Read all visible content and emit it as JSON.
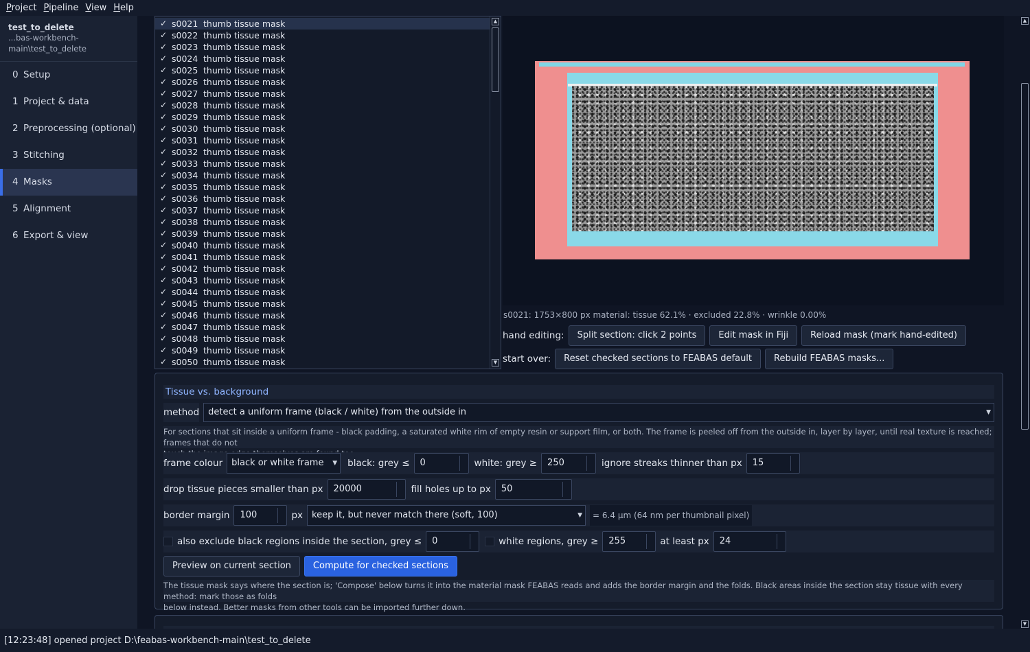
{
  "menu": [
    {
      "label": "Project",
      "ul": "P",
      "rest": "roject"
    },
    {
      "label": "Pipeline",
      "ul": "P",
      "rest": "ipeline"
    },
    {
      "label": "View",
      "ul": "V",
      "rest": "iew"
    },
    {
      "label": "Help",
      "ul": "H",
      "rest": "elp"
    }
  ],
  "sidebar": {
    "project_name": "test_to_delete",
    "project_path_1": "...bas-workbench-",
    "project_path_2": "main\\test_to_delete",
    "items": [
      {
        "num": "0",
        "label": "Setup"
      },
      {
        "num": "1",
        "label": "Project & data"
      },
      {
        "num": "2",
        "label": "Preprocessing (optional)"
      },
      {
        "num": "3",
        "label": "Stitching"
      },
      {
        "num": "4",
        "label": "Masks",
        "active": true
      },
      {
        "num": "5",
        "label": "Alignment"
      },
      {
        "num": "6",
        "label": "Export & view"
      }
    ]
  },
  "section_list": {
    "check_glyph": "✓",
    "kind": "thumb tissue mask",
    "rows": [
      "s0021",
      "s0022",
      "s0023",
      "s0024",
      "s0025",
      "s0026",
      "s0027",
      "s0028",
      "s0029",
      "s0030",
      "s0031",
      "s0032",
      "s0033",
      "s0034",
      "s0035",
      "s0036",
      "s0037",
      "s0038",
      "s0039",
      "s0040",
      "s0041",
      "s0042",
      "s0043",
      "s0044",
      "s0045",
      "s0046",
      "s0047",
      "s0048",
      "s0049",
      "s0050"
    ]
  },
  "preview": {
    "info": "s0021: 1753×800 px   material: tissue 62.1% · excluded 22.8% · wrinkle 0.00%",
    "colors": {
      "excluded": "#ef8f8f",
      "border": "#8ad9e8"
    }
  },
  "hand_editing": {
    "label": "hand editing:",
    "split": "Split section: click 2 points",
    "edit_fiji": "Edit mask in Fiji",
    "reload": "Reload mask (mark hand-edited)"
  },
  "start_over": {
    "label": "start over:",
    "reset": "Reset checked sections to FEABAS default",
    "rebuild": "Rebuild FEABAS masks..."
  },
  "tissue": {
    "title": "Tissue vs. background",
    "method_label": "method",
    "method_value": "detect a uniform frame (black / white) from the outside in",
    "method_desc_1": "For sections that sit inside a uniform frame - black padding, a saturated white rim of empty resin or support film, or both. The frame is peeled off from the outside in, layer by layer, until real texture is reached; frames that do not",
    "method_desc_2": "touch the image edge themselves are found too.",
    "frame_colour_label": "frame colour",
    "frame_colour_value": "black or white frame",
    "black_label": "black: grey ≤",
    "black_value": "0",
    "white_label": "white: grey ≥",
    "white_value": "250",
    "streaks_label": "ignore streaks thinner than px",
    "streaks_value": "15",
    "drop_label": "drop tissue pieces smaller than px",
    "drop_value": "20000",
    "fill_label": "fill holes up to px",
    "fill_value": "50",
    "border_label": "border margin",
    "border_value": "100",
    "border_unit": "px",
    "border_mode": "keep it, but never match there (soft, 100)",
    "border_note": "= 6.4 µm (64 nm per thumbnail pixel)",
    "exclude_black_label": "also exclude black regions inside the section, grey ≤",
    "exclude_black_value": "0",
    "white_regions_label": "white regions, grey ≥",
    "white_regions_value": "255",
    "at_least_label": "at least px",
    "at_least_value": "24",
    "preview_btn": "Preview on current section",
    "compute_btn": "Compute for checked sections",
    "footer_1": "The tissue mask says where the section is; 'Compose' below turns it into the material mask FEABAS reads and adds the border margin and the folds. Black areas inside the section stay tissue with every method: mark those as folds",
    "footer_2": "below instead. Better masks from other tools can be imported further down."
  },
  "status": "[12:23:48] opened project D:\\feabas-workbench-main\\test_to_delete"
}
